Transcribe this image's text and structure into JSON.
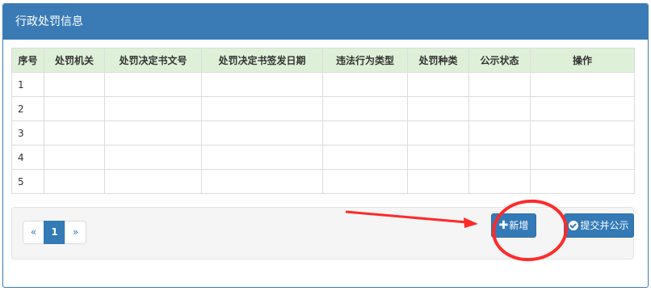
{
  "panel": {
    "title": "行政处罚信息"
  },
  "table": {
    "headers": [
      "序号",
      "处罚机关",
      "处罚决定书文号",
      "处罚决定书签发日期",
      "违法行为类型",
      "处罚种类",
      "公示状态",
      "操作"
    ],
    "rows": [
      [
        "1",
        "",
        "",
        "",
        "",
        "",
        "",
        ""
      ],
      [
        "2",
        "",
        "",
        "",
        "",
        "",
        "",
        ""
      ],
      [
        "3",
        "",
        "",
        "",
        "",
        "",
        "",
        ""
      ],
      [
        "4",
        "",
        "",
        "",
        "",
        "",
        "",
        ""
      ],
      [
        "5",
        "",
        "",
        "",
        "",
        "",
        "",
        ""
      ]
    ]
  },
  "pagination": {
    "prev": "«",
    "current": "1",
    "next": "»"
  },
  "actions": {
    "add_label": "新增",
    "submit_label": "提交并公示"
  },
  "colors": {
    "header_blue": "#3a7bb6",
    "table_header_green": "#dff0d8",
    "button_blue": "#337ab7",
    "annotation_red": "#ff2a2a"
  },
  "icons": {
    "add": "plus-icon",
    "submit": "check-circle-icon"
  }
}
